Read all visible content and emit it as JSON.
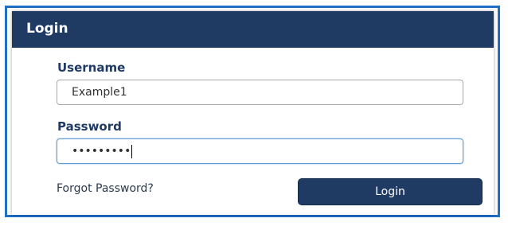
{
  "login_panel": {
    "title": "Login",
    "username": {
      "label": "Username",
      "value": "Example1"
    },
    "password": {
      "label": "Password",
      "masked_value": "•••••••••"
    },
    "forgot_password_link": "Forgot Password?",
    "login_button": "Login"
  },
  "colors": {
    "header_background": "#1f3a63",
    "frame_border": "#1f6fc6",
    "button_background": "#1f3a63",
    "label_text": "#1f3a63"
  }
}
